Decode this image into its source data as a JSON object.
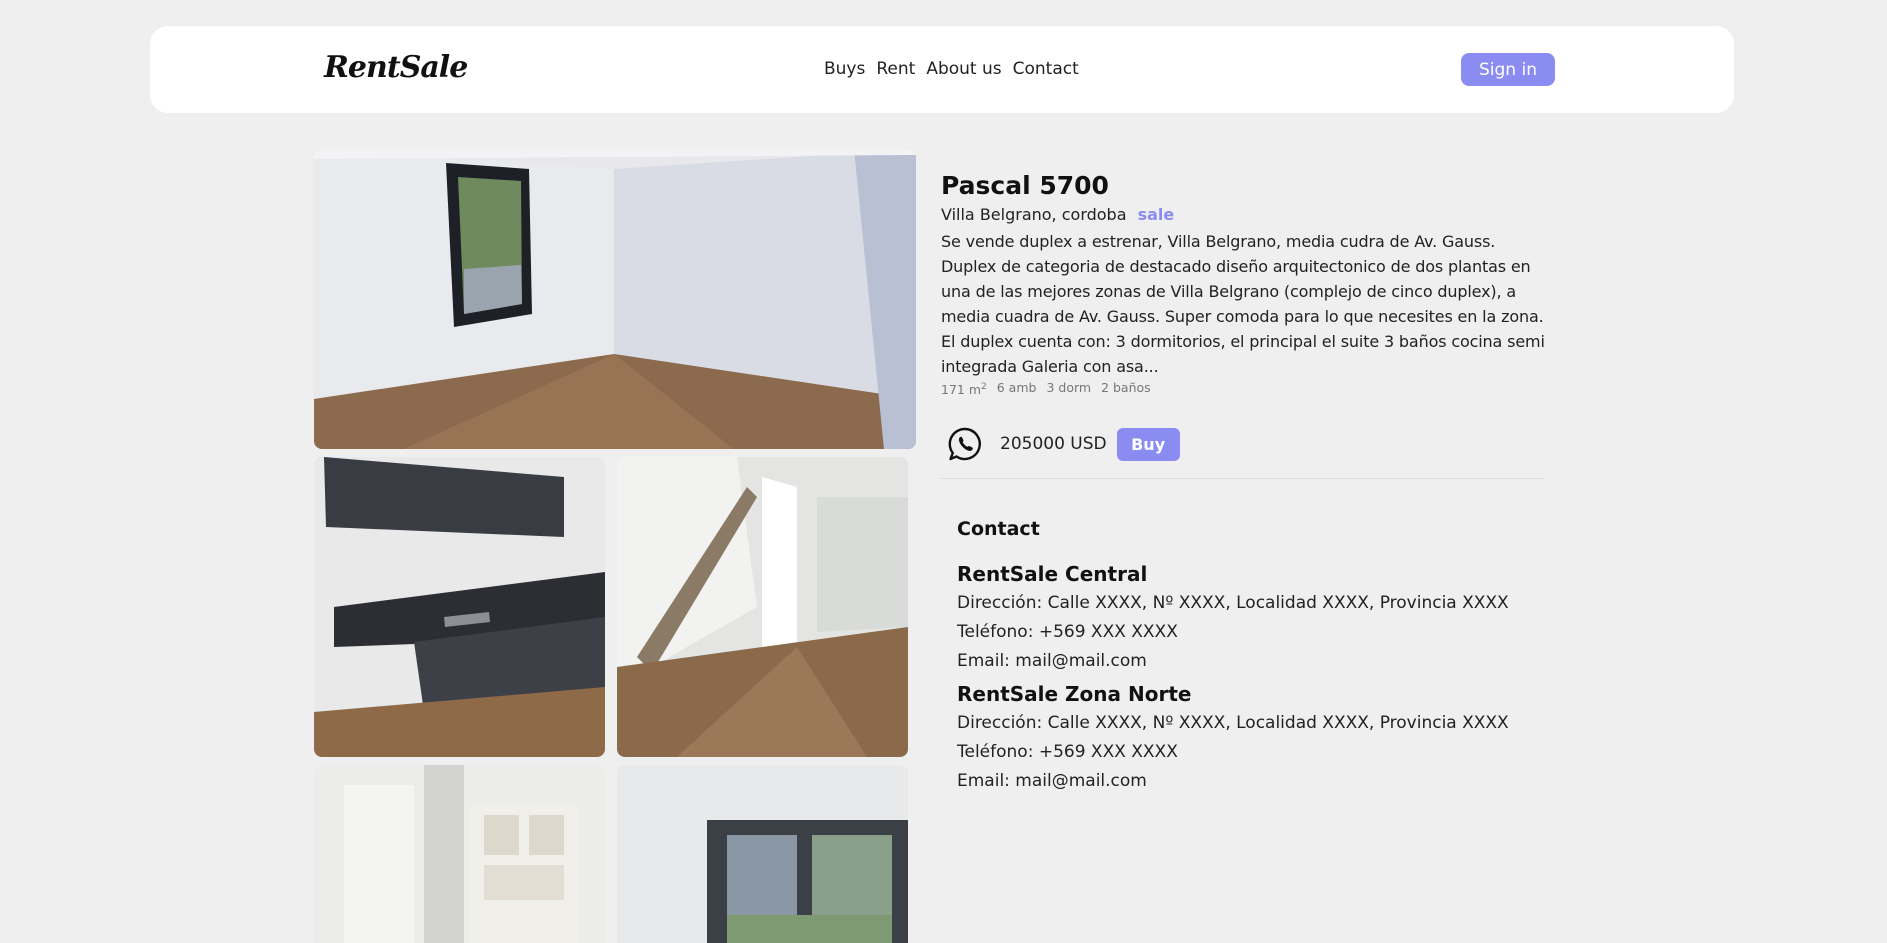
{
  "nav": {
    "logo": "RentSale",
    "links": [
      "Buys",
      "Rent",
      "About us",
      "Contact"
    ],
    "signin_label": "Sign in"
  },
  "listing": {
    "title": "Pascal 5700",
    "location": "Villa Belgrano, cordoba",
    "tag": "sale",
    "description": "Se vende duplex a estrenar, Villa Belgrano, media cudra de Av. Gauss. Duplex de categoria de destacado diseño arquitectonico de dos plantas en una de las mejores zonas de Villa Belgrano (complejo de cinco duplex), a media cuadra de Av. Gauss. Super comoda para lo que necesites en la zona. El duplex cuenta con: 3 dormitorios, el principal el suite 3 baños cocina semi integrada Galeria con asa...",
    "specs": {
      "area": "171 m",
      "area_sup": "2",
      "rooms": "6 amb",
      "bedrooms": "3 dorm",
      "baths": "2 baños"
    },
    "price": "205000 USD",
    "buy_label": "Buy",
    "whatsapp_icon": "whatsapp-icon"
  },
  "contact": {
    "title": "Contact",
    "offices": [
      {
        "name": "RentSale Central",
        "address": "Dirección: Calle XXXX, Nº XXXX, Localidad XXXX, Provincia XXXX",
        "phone": "Teléfono: +569 XXX XXXX",
        "email": "Email: mail@mail.com"
      },
      {
        "name": "RentSale Zona Norte",
        "address": "Dirección: Calle XXXX, Nº XXXX, Localidad XXXX, Provincia XXXX",
        "phone": "Teléfono: +569 XXX XXXX",
        "email": "Email: mail@mail.com"
      }
    ]
  },
  "colors": {
    "accent": "#8b8cf2",
    "background": "#efefef",
    "card": "#ffffff"
  }
}
